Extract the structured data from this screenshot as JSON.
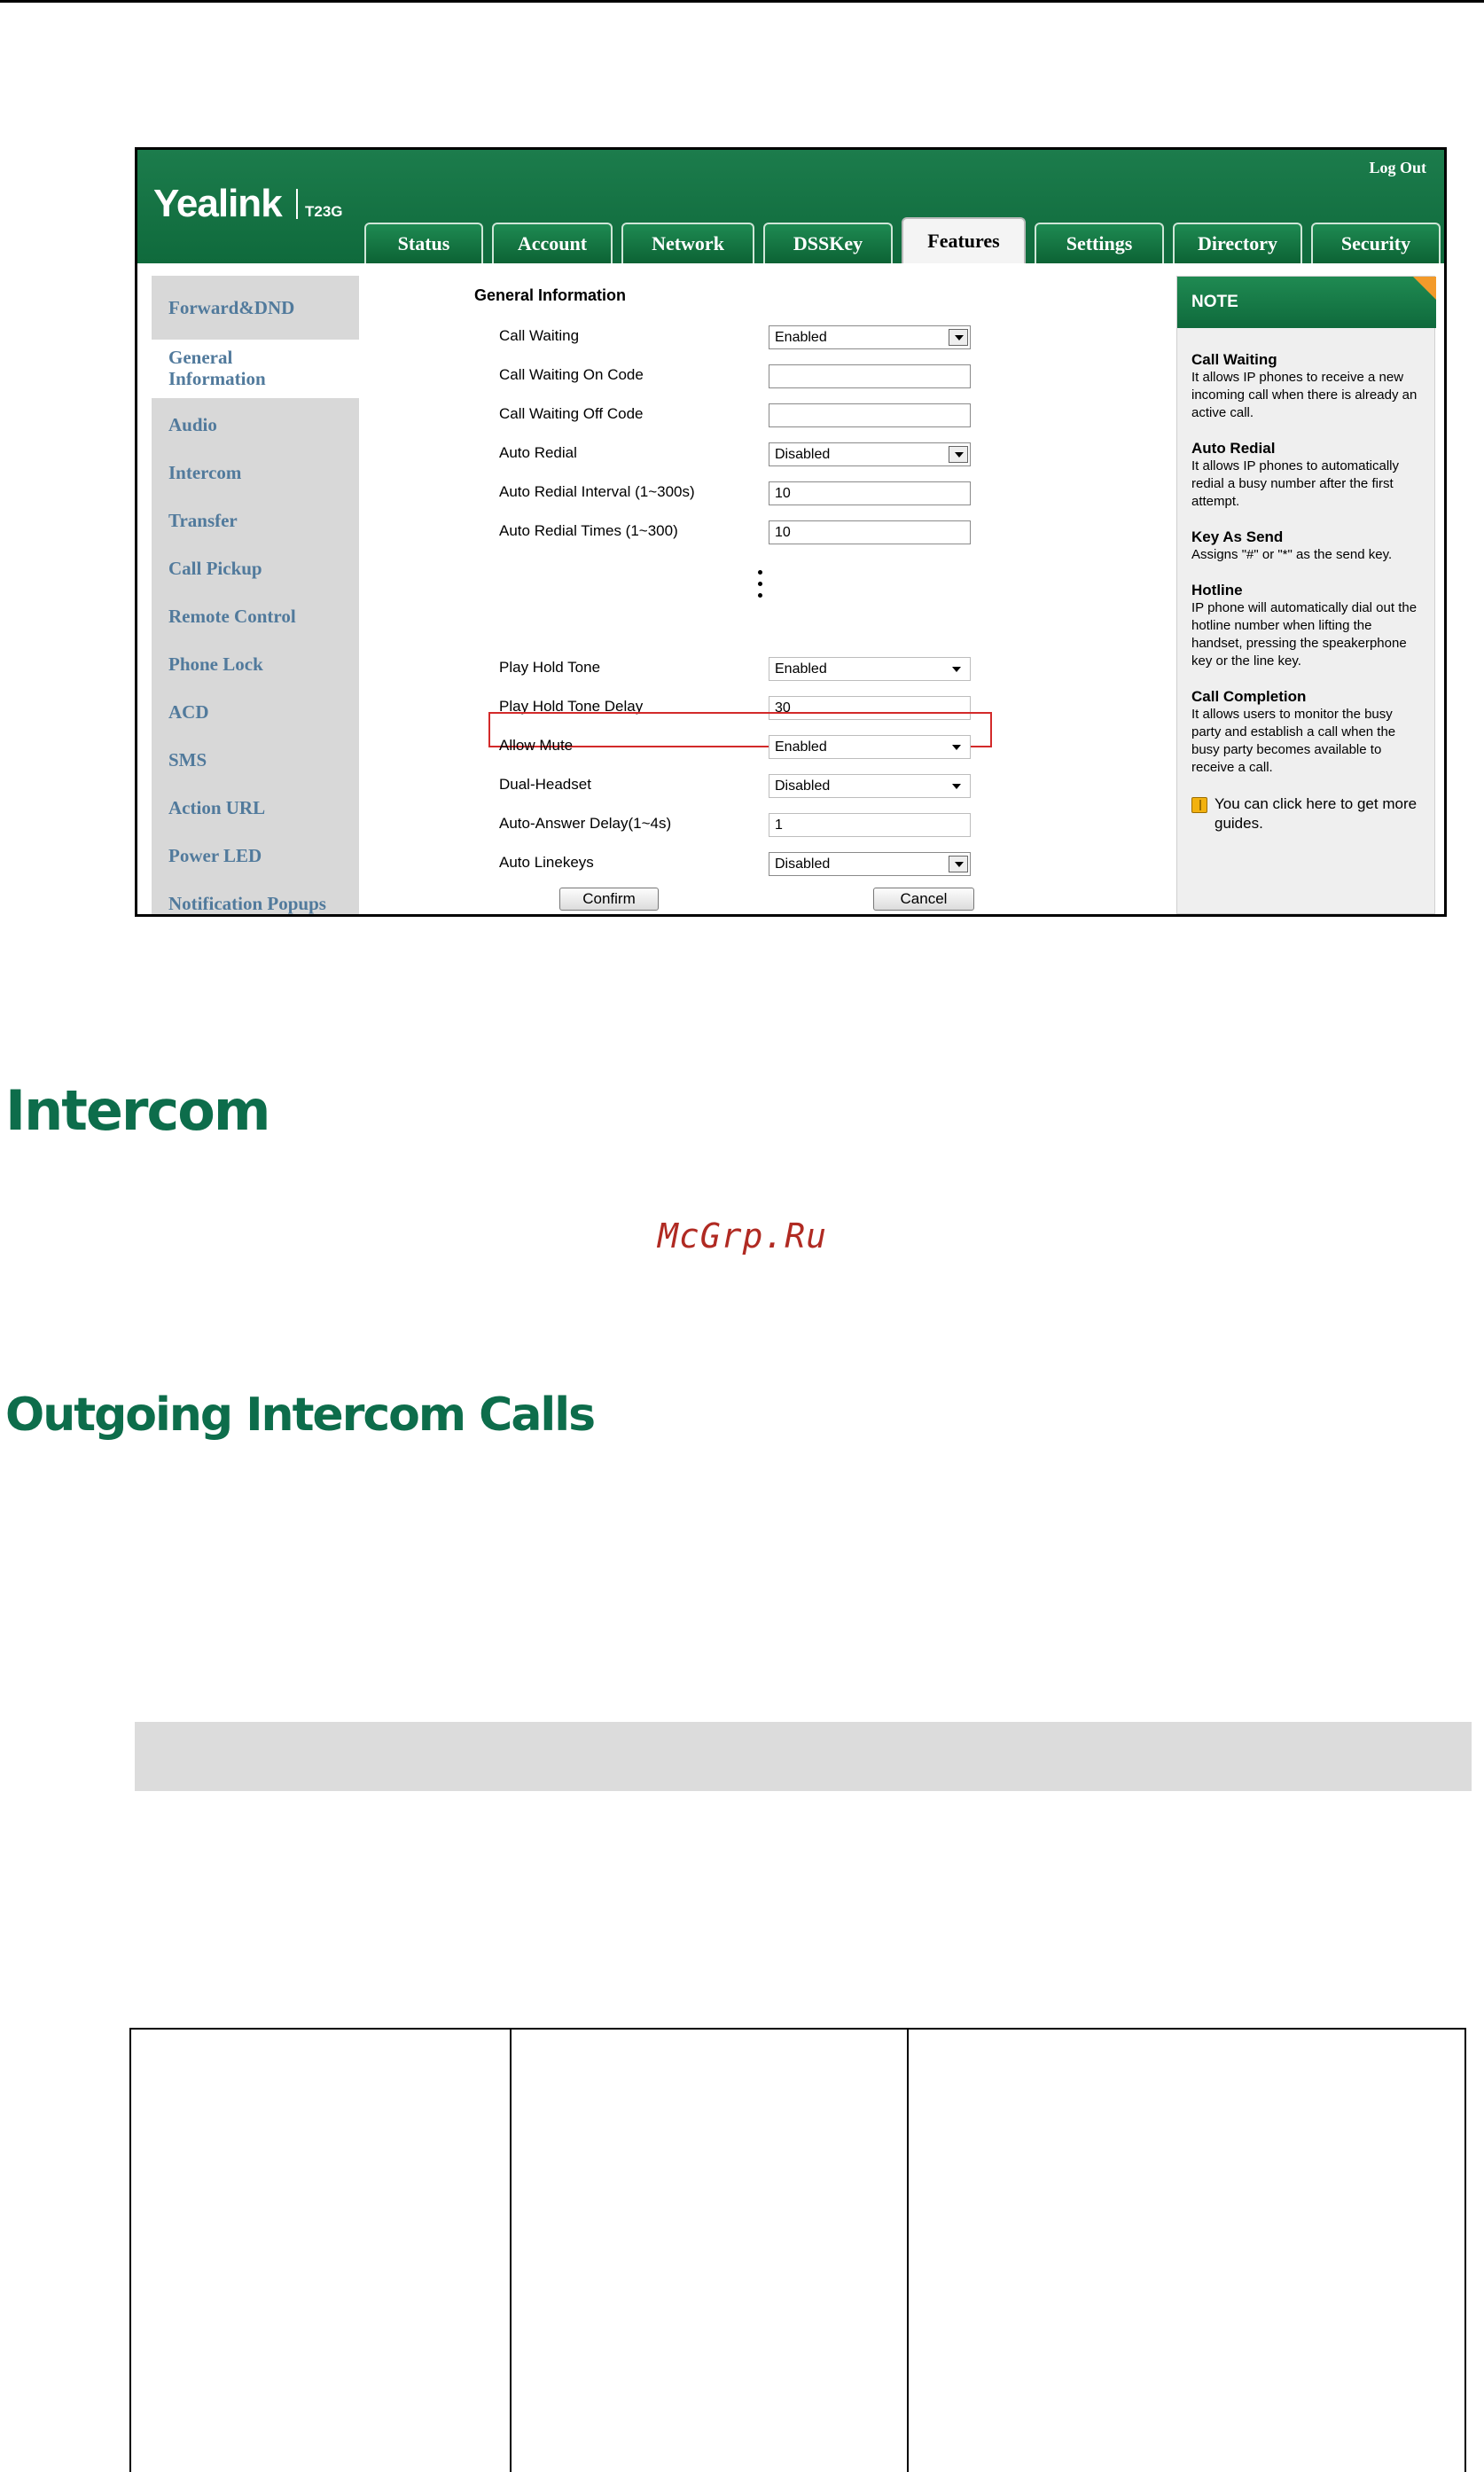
{
  "header": {
    "brand": "Yealink",
    "model": "T23G",
    "logout": "Log Out",
    "tabs": [
      "Status",
      "Account",
      "Network",
      "DSSKey",
      "Features",
      "Settings",
      "Directory",
      "Security"
    ],
    "active_tab": "Features"
  },
  "sidebar": {
    "items": [
      "Forward&DND",
      "General Information",
      "Audio",
      "Intercom",
      "Transfer",
      "Call Pickup",
      "Remote Control",
      "Phone Lock",
      "ACD",
      "SMS",
      "Action URL",
      "Power LED",
      "Notification Popups"
    ],
    "active_first_line": "General",
    "active_second_line": "Information"
  },
  "form": {
    "section_title": "General Information",
    "rows": [
      {
        "label": "Call Waiting",
        "value": "Enabled",
        "type": "select"
      },
      {
        "label": "Call Waiting On Code",
        "value": "",
        "type": "text"
      },
      {
        "label": "Call Waiting Off Code",
        "value": "",
        "type": "text"
      },
      {
        "label": "Auto Redial",
        "value": "Disabled",
        "type": "select"
      },
      {
        "label": "Auto Redial Interval (1~300s)",
        "value": "10",
        "type": "text"
      },
      {
        "label": "Auto Redial Times (1~300)",
        "value": "10",
        "type": "text"
      },
      {
        "label": "Play Hold Tone",
        "value": "Enabled",
        "type": "select2"
      },
      {
        "label": "Play Hold Tone Delay",
        "value": "30",
        "type": "text"
      },
      {
        "label": "Allow Mute",
        "value": "Enabled",
        "type": "select2"
      },
      {
        "label": "Dual-Headset",
        "value": "Disabled",
        "type": "select2"
      },
      {
        "label": "Auto-Answer Delay(1~4s)",
        "value": "1",
        "type": "text"
      },
      {
        "label": "Auto Linekeys",
        "value": "Disabled",
        "type": "select"
      }
    ],
    "confirm": "Confirm",
    "cancel": "Cancel"
  },
  "note": {
    "heading": "NOTE",
    "entries": [
      {
        "title": "Call Waiting",
        "text": "It allows IP phones to receive a new incoming call when there is already an active call."
      },
      {
        "title": "Auto Redial",
        "text": "It allows IP phones to automatically redial a busy number after the first attempt."
      },
      {
        "title": "Key As Send",
        "text": "Assigns \"#\" or \"*\" as the send key."
      },
      {
        "title": "Hotline",
        "text": "IP phone will automatically dial out the hotline number when lifting the handset, pressing the speakerphone key or the line key."
      },
      {
        "title": "Call Completion",
        "text": "It allows users to monitor the busy party and establish a call when the busy party becomes available to receive a call."
      }
    ],
    "guide": "You can click here to get more guides."
  },
  "document": {
    "heading_intercom": "Intercom",
    "watermark": "McGrp.Ru",
    "heading_outgoing": "Outgoing Intercom Calls"
  }
}
